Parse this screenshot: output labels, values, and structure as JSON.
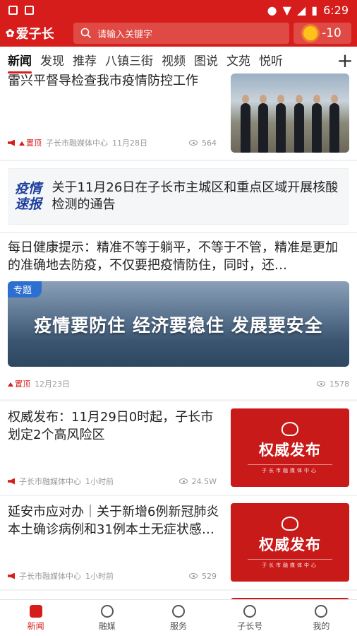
{
  "status_bar": {
    "time": "6:29"
  },
  "header": {
    "logo_text": "爱子长",
    "search_placeholder": "请输入关键字",
    "temperature": "-10"
  },
  "tabs": [
    "新闻",
    "发现",
    "推荐",
    "八镇三街",
    "视频",
    "图说",
    "文苑",
    "悦听"
  ],
  "tab_more_icon": "plus-icon",
  "feed": {
    "item1": {
      "title": "雷兴平督导检查我市疫情防控工作",
      "pinned": "置顶",
      "source": "子长市融媒体中心",
      "date": "11月28日",
      "views": "564"
    },
    "notice": {
      "badge_line1": "疫情",
      "badge_line2": "速报",
      "text": "关于11月26日在子长市主城区和重点区域开展核酸检测的通告"
    },
    "item2": {
      "title": "每日健康提示：精准不等于躺平，不等于不管，精准是更加的准确地去防疫，不仅要把疫情防住，同时，还…",
      "tag": "专题",
      "slogan": "疫情要防住  经济要稳住  发展要安全",
      "pinned": "置顶",
      "date": "12月23日",
      "views": "1578"
    },
    "item3": {
      "title": "权威发布：11月29日0时起，子长市划定2个高风险区",
      "thumb_title": "权威发布",
      "thumb_sub": "子长市融媒体中心",
      "source": "子长市融媒体中心",
      "date": "1小时前",
      "views": "24.5W"
    },
    "item4": {
      "title": "延安市应对办｜关于新增6例新冠肺炎本土确诊病例和31例本土无症状感…",
      "thumb_title": "权威发布",
      "thumb_sub": "子长市融媒体中心",
      "source": "子长市融媒体中心",
      "date": "1小时前",
      "views": "529"
    }
  },
  "bottom_nav": [
    "新闻",
    "融媒",
    "服务",
    "子长号",
    "我的"
  ],
  "colors": {
    "brand_red": "#d71c1c",
    "tag_blue": "#2d6fd1",
    "notice_blue": "#1d3f9e"
  }
}
